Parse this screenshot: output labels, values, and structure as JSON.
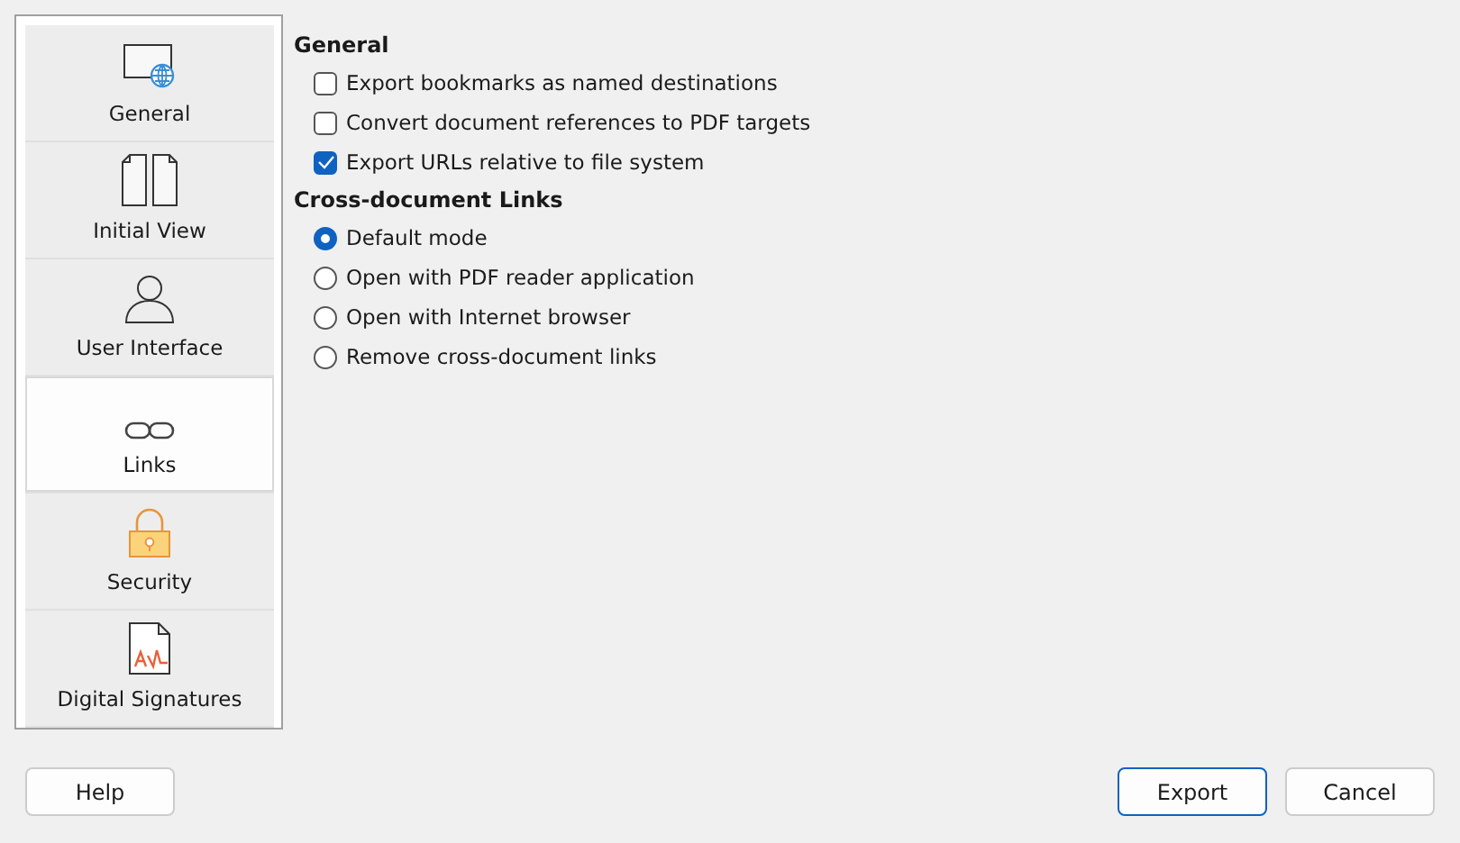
{
  "sidebar": {
    "items": [
      {
        "kind": "general",
        "label": "General",
        "selected": false
      },
      {
        "kind": "view",
        "label": "Initial View",
        "selected": false
      },
      {
        "kind": "user",
        "label": "User Interface",
        "selected": false
      },
      {
        "kind": "links",
        "label": "Links",
        "selected": true
      },
      {
        "kind": "security",
        "label": "Security",
        "selected": false
      },
      {
        "kind": "signature",
        "label": "Digital Signatures",
        "selected": false
      }
    ]
  },
  "sections": [
    {
      "kind": "checkbox",
      "title": "General",
      "options": [
        {
          "label": "Export bookmarks as named destinations",
          "checked": false
        },
        {
          "label": "Convert document references to PDF targets",
          "checked": false
        },
        {
          "label": "Export URLs relative to file system",
          "checked": true
        }
      ]
    },
    {
      "kind": "radio",
      "title": "Cross-document Links",
      "options": [
        {
          "label": "Default mode",
          "selected": true
        },
        {
          "label": "Open with PDF reader application",
          "selected": false
        },
        {
          "label": "Open with Internet browser",
          "selected": false
        },
        {
          "label": "Remove cross-document links",
          "selected": false
        }
      ]
    }
  ],
  "buttons": [
    {
      "label": "Help",
      "kind": "plain"
    },
    {
      "label": "Export",
      "kind": "default"
    },
    {
      "label": "Cancel",
      "kind": "plain"
    }
  ]
}
